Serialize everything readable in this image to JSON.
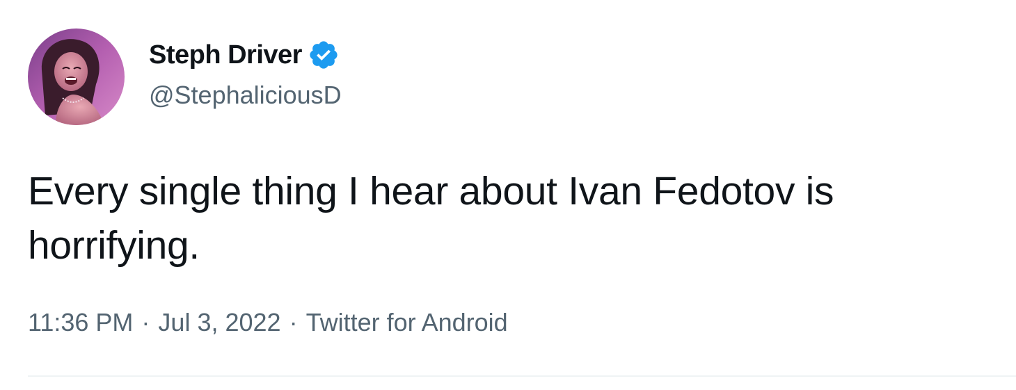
{
  "tweet": {
    "author": {
      "display_name": "Steph Driver",
      "handle": "@StephaliciousD",
      "verified": true,
      "avatar_icon": "user-avatar-photo"
    },
    "text": "Every single thing I hear about Ivan Fedotov is horrifying.",
    "time": "11:36 PM",
    "separator": "·",
    "date": "Jul 3, 2022",
    "source": "Twitter for Android",
    "colors": {
      "text": "#0f1419",
      "secondary": "#536471",
      "verified_badge": "#1d9bf0",
      "divider": "#eff3f4"
    }
  }
}
